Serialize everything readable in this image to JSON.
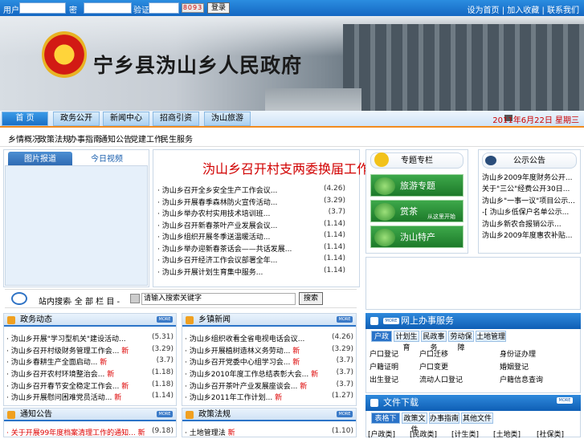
{
  "topbar": {
    "user_label": "用户名",
    "pass_label": "密　码",
    "code_label": "验证码",
    "captcha": "8093",
    "login": "登录",
    "links": [
      "设为首页",
      "加入收藏",
      "联系我们"
    ]
  },
  "banner": {
    "title": "宁乡县沩山乡人民政府"
  },
  "nav1": {
    "tabs": [
      "首 页",
      "政务公开",
      "新闻中心",
      "招商引资",
      "沩山旅游"
    ],
    "active_index": 0
  },
  "datebar": {
    "text": "2011年6月22日 星期三"
  },
  "nav2": {
    "items": [
      "乡情概况",
      "政策法规",
      "办事指南",
      "通知公告",
      "党建工作",
      "民生服务"
    ]
  },
  "photo_panel": {
    "tabs": [
      "图片报道",
      "今日视频"
    ]
  },
  "headline": {
    "text": "沩山乡召开村支两委换届工作..."
  },
  "news": [
    {
      "title": "沩山乡召开全乡安全生产工作会议...",
      "date": "(4.26)"
    },
    {
      "title": "沩山乡开展春季森林防火宣传活动...",
      "date": "(3.29)"
    },
    {
      "title": "沩山乡举办农村实用技术培训班...",
      "date": "(3.7)"
    },
    {
      "title": "沩山乡召开新春茶叶产业发展会议...",
      "date": "(1.14)"
    },
    {
      "title": "沩山乡组织开展冬季送温暖活动...",
      "date": "(1.14)"
    },
    {
      "title": "沩山乡举办迎新春茶话会——共话发展...",
      "date": "(1.14)"
    },
    {
      "title": "沩山乡召开经济工作会议部署全年...",
      "date": "(1.14)"
    },
    {
      "title": "沩山乡开展计划生育集中服务...",
      "date": "(1.14)"
    }
  ],
  "search": {
    "type": "站内搜索",
    "scope": "- 全 部 栏 目 -",
    "input_value": "请输入搜索关键字",
    "button": "搜索"
  },
  "theme_panel": {
    "title": "专题专栏",
    "buttons": [
      {
        "label": "旅游专题",
        "sub": ""
      },
      {
        "label": "赏茶",
        "sub": "从这里开始"
      },
      {
        "label": "沩山特产",
        "sub": ""
      }
    ]
  },
  "notice_panel": {
    "title": "公示公告",
    "items": [
      "沩山乡2009年度财务公开...",
      "关于\"三公\"经费公开30日...",
      "沩山乡\"一事一议\"项目公示...",
      "-[ 沩山乡低保户名单公示...",
      "沩山乡新农合报销公示...",
      "沩山乡2009年度惠农补贴..."
    ]
  },
  "blocks": [
    {
      "title": "政务动态",
      "items": [
        {
          "t": "沩山乡开展\"学习型机关\"建设活动...",
          "d": "(5.31)",
          "new": false
        },
        {
          "t": "沩山乡召开村级财务管理工作会...",
          "d": "(3.29)",
          "new": true
        },
        {
          "t": "沩山乡春耕生产全面启动...",
          "d": "(3.7)",
          "new": true
        },
        {
          "t": "沩山乡召开农村环境整治会...",
          "d": "(1.18)",
          "new": true
        },
        {
          "t": "沩山乡召开春节安全稳定工作会...",
          "d": "(1.18)",
          "new": true
        },
        {
          "t": "沩山乡开展慰问困难党员活动...",
          "d": "(1.14)",
          "new": true
        }
      ]
    },
    {
      "title": "乡镇新闻",
      "items": [
        {
          "t": "沩山乡组织收看全省电视电话会议...",
          "d": "(4.26)",
          "new": false
        },
        {
          "t": "沩山乡开展植树造林义务劳动...",
          "d": "(3.29)",
          "new": true
        },
        {
          "t": "沩山乡召开党委中心组学习会...",
          "d": "(3.7)",
          "new": true
        },
        {
          "t": "沩山乡2010年度工作总结表彰大会...",
          "d": "(3.7)",
          "new": true
        },
        {
          "t": "沩山乡召开茶叶产业发展座谈会...",
          "d": "(3.7)",
          "new": true
        },
        {
          "t": "沩山乡2011年工作计划...",
          "d": "(1.27)",
          "new": true
        }
      ]
    },
    {
      "title": "通知公告",
      "items": [
        {
          "t": "关于开展99年度档案清理工作的通知...",
          "d": "(9.18)",
          "new": true
        }
      ]
    },
    {
      "title": "政策法规",
      "items": [
        {
          "t": "土地管理法",
          "d": "(1.10)",
          "new": true
        }
      ]
    }
  ],
  "online_service": {
    "title": "网上办事服务",
    "tabs": [
      "户政",
      "计划生育",
      "民政事务",
      "劳动保障",
      "土地管理"
    ],
    "rows": [
      [
        "户口登记",
        "户口迁移",
        "身份证办理"
      ],
      [
        "户籍证明",
        "户口变更",
        "婚姻登记"
      ],
      [
        "出生登记",
        "流动人口登记",
        "户籍信息查询"
      ]
    ]
  },
  "file_download": {
    "title": "文件下载",
    "tabs": [
      "表格下载",
      "政策文件",
      "办事指南",
      "其他文件"
    ],
    "items": [
      "[户政类]",
      "[民政类]",
      "[计生类]",
      "[土地类]",
      "[社保类]"
    ]
  },
  "colors": {
    "brand_blue": "#1467c2",
    "accent_orange": "#f28b1e",
    "headline_red": "#d10000",
    "green": "#1d7a2a"
  }
}
